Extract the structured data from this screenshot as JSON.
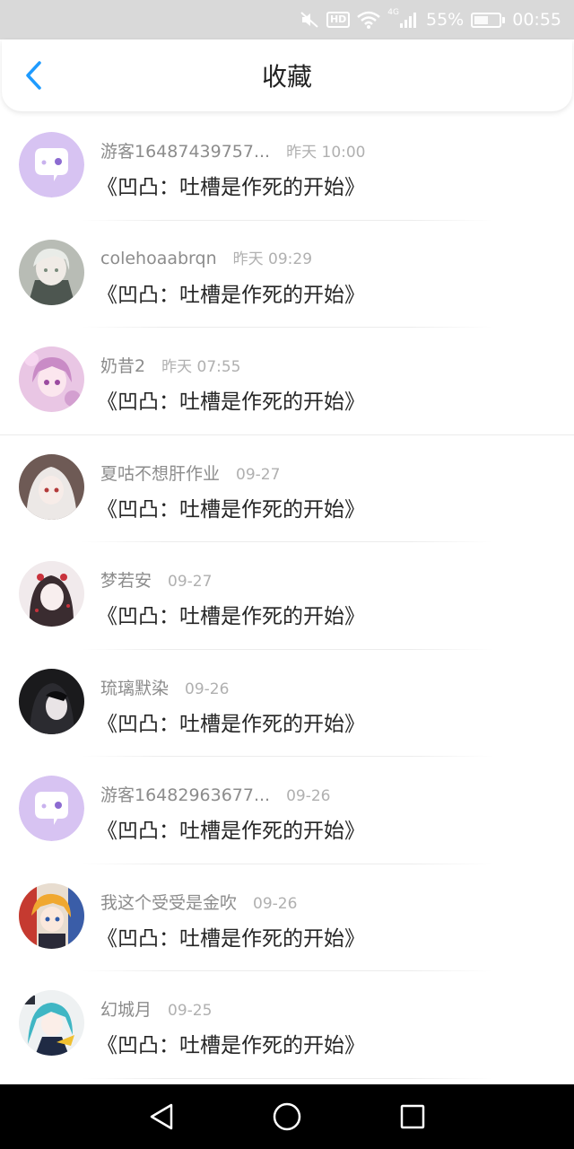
{
  "status_bar": {
    "hd": "HD",
    "network": "4G",
    "battery_percent": "55%",
    "battery_level": 0.55,
    "time": "00:55",
    "icons": [
      "mute-icon",
      "hd-icon",
      "wifi-icon",
      "signal-icon",
      "battery-icon"
    ]
  },
  "header": {
    "title": "收藏",
    "back_icon": "chevron-left-icon",
    "accent_color": "#1e9bff"
  },
  "items": [
    {
      "username": "游客16487439757...",
      "time": "昨天 10:00",
      "title": "《凹凸：吐槽是作死的开始》",
      "avatar": "default-chat-bubble"
    },
    {
      "username": "colehoaabrqn",
      "time": "昨天 09:29",
      "title": "《凹凸：吐槽是作死的开始》",
      "avatar": "anime-boy-white-hair"
    },
    {
      "username": "奶昔2",
      "time": "昨天 07:55",
      "title": "《凹凸：吐槽是作死的开始》",
      "avatar": "anime-girl-pink"
    },
    {
      "username": "夏咕不想肝作业",
      "time": "09-27",
      "title": "《凹凸：吐槽是作死的开始》",
      "avatar": "anime-girl-white-hair"
    },
    {
      "username": "梦若安",
      "time": "09-27",
      "title": "《凹凸：吐槽是作死的开始》",
      "avatar": "anime-girl-dark-hair-red"
    },
    {
      "username": "琉璃默染",
      "time": "09-26",
      "title": "《凹凸：吐槽是作死的开始》",
      "avatar": "anime-girl-black"
    },
    {
      "username": "游客16482963677...",
      "time": "09-26",
      "title": "《凹凸：吐槽是作死的开始》",
      "avatar": "default-chat-bubble"
    },
    {
      "username": "我这个受受是金吹",
      "time": "09-26",
      "title": "《凹凸：吐槽是作死的开始》",
      "avatar": "anime-colorful"
    },
    {
      "username": "幻城月",
      "time": "09-25",
      "title": "《凹凸：吐槽是作死的开始》",
      "avatar": "anime-girl-teal"
    }
  ],
  "nav_bar": {
    "icons": [
      "back-triangle-icon",
      "home-circle-icon",
      "recents-square-icon"
    ]
  }
}
